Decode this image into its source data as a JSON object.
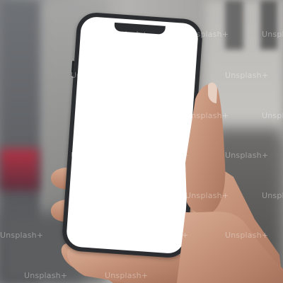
{
  "watermark": {
    "text": "Unsplash+"
  },
  "colors": {
    "phone_body": "#2b2d30",
    "screen": "#ffffff",
    "skin": "#c8987f"
  }
}
